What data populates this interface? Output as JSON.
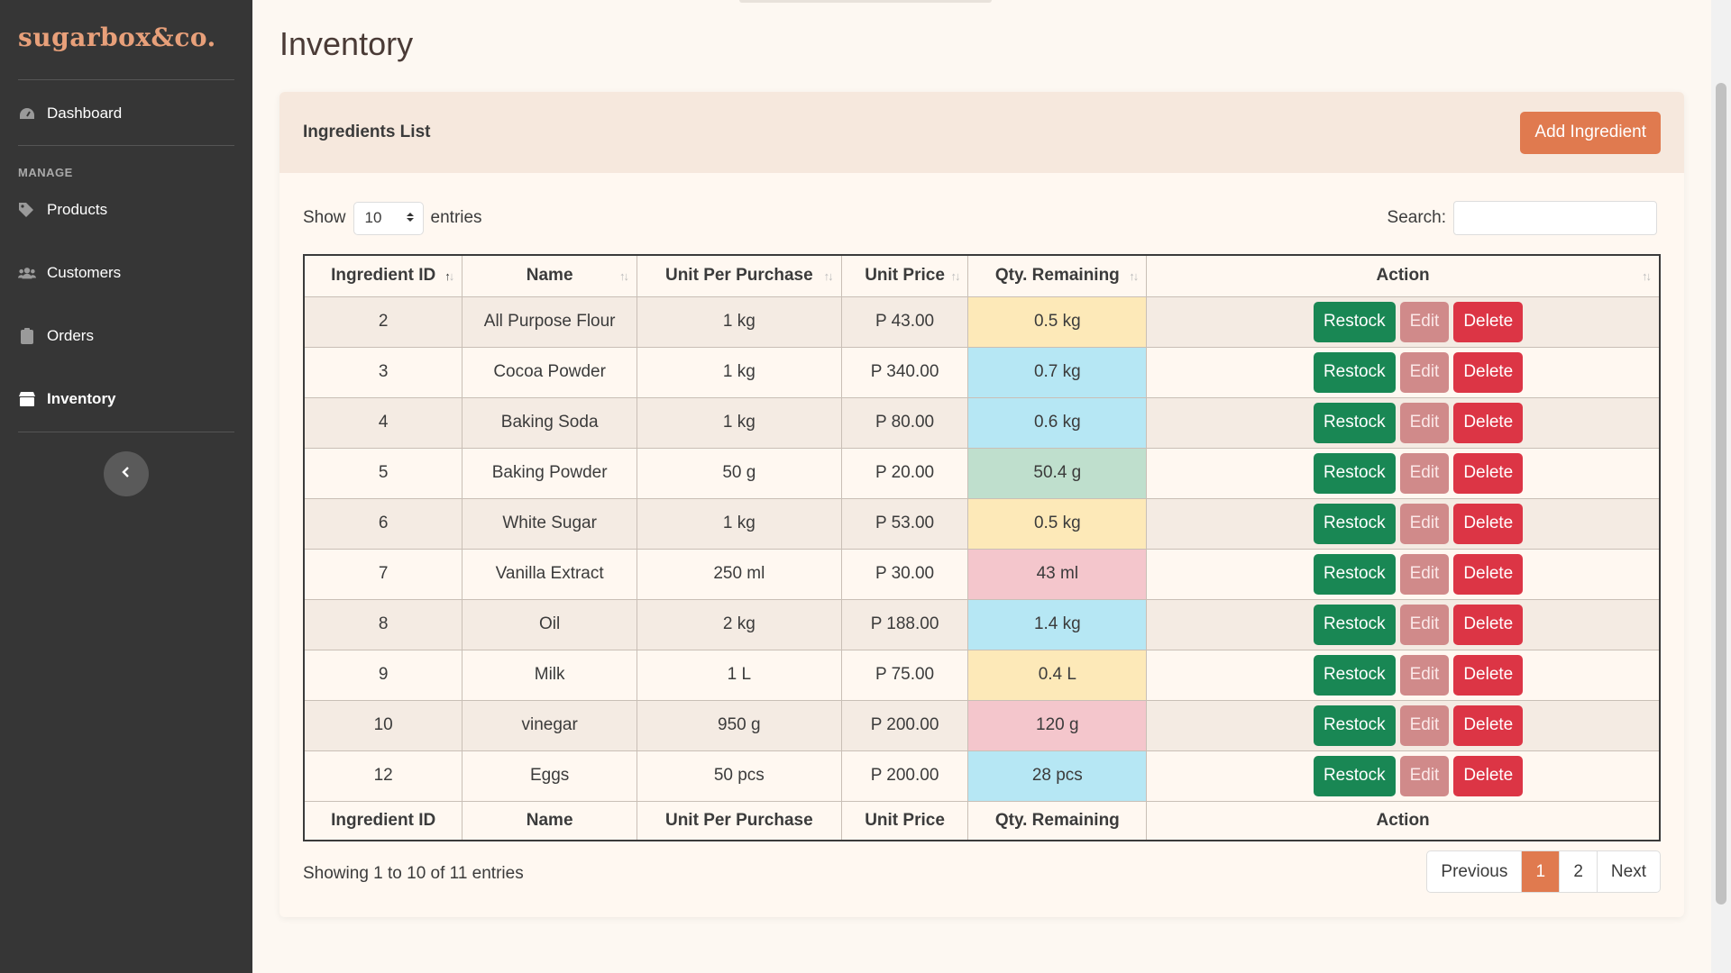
{
  "brand": "sugarbox&co.",
  "sidebar": {
    "dashboard": "Dashboard",
    "heading": "MANAGE",
    "items": [
      {
        "label": "Products",
        "icon": "tags-icon"
      },
      {
        "label": "Customers",
        "icon": "users-icon"
      },
      {
        "label": "Orders",
        "icon": "clipboard-icon"
      },
      {
        "label": "Inventory",
        "icon": "box-icon",
        "active": true
      }
    ]
  },
  "page": {
    "title": "Inventory"
  },
  "card": {
    "title": "Ingredients List",
    "add_label": "Add Ingredient"
  },
  "controls": {
    "show_label": "Show",
    "entries_value": "10",
    "entries_label": "entries",
    "search_label": "Search:",
    "search_value": ""
  },
  "table": {
    "columns": [
      "Ingredient ID",
      "Name",
      "Unit Per Purchase",
      "Unit Price",
      "Qty. Remaining",
      "Action"
    ],
    "rows": [
      {
        "id": "2",
        "name": "All Purpose Flour",
        "unit": "1 kg",
        "price": "P 43.00",
        "qty": "0.5 kg",
        "status": "warn"
      },
      {
        "id": "3",
        "name": "Cocoa Powder",
        "unit": "1 kg",
        "price": "P 340.00",
        "qty": "0.7 kg",
        "status": "info"
      },
      {
        "id": "4",
        "name": "Baking Soda",
        "unit": "1 kg",
        "price": "P 80.00",
        "qty": "0.6 kg",
        "status": "info"
      },
      {
        "id": "5",
        "name": "Baking Powder",
        "unit": "50 g",
        "price": "P 20.00",
        "qty": "50.4 g",
        "status": "ok"
      },
      {
        "id": "6",
        "name": "White Sugar",
        "unit": "1 kg",
        "price": "P 53.00",
        "qty": "0.5 kg",
        "status": "warn"
      },
      {
        "id": "7",
        "name": "Vanilla Extract",
        "unit": "250 ml",
        "price": "P 30.00",
        "qty": "43 ml",
        "status": "danger"
      },
      {
        "id": "8",
        "name": "Oil",
        "unit": "2 kg",
        "price": "P 188.00",
        "qty": "1.4 kg",
        "status": "info"
      },
      {
        "id": "9",
        "name": "Milk",
        "unit": "1 L",
        "price": "P 75.00",
        "qty": "0.4 L",
        "status": "warn"
      },
      {
        "id": "10",
        "name": "vinegar",
        "unit": "950 g",
        "price": "P 200.00",
        "qty": "120 g",
        "status": "danger"
      },
      {
        "id": "12",
        "name": "Eggs",
        "unit": "50 pcs",
        "price": "P 200.00",
        "qty": "28 pcs",
        "status": "info"
      }
    ],
    "actions": {
      "restock": "Restock",
      "edit": "Edit",
      "delete": "Delete"
    }
  },
  "footer": {
    "info": "Showing 1 to 10 of 11 entries",
    "pagination": {
      "previous": "Previous",
      "pages": [
        "1",
        "2"
      ],
      "current": "1",
      "next": "Next"
    }
  },
  "colors": {
    "accent": "#e07a4f",
    "sidebar": "#363636",
    "restock": "#198754",
    "delete": "#dc3545",
    "edit": "#d08a8a"
  }
}
